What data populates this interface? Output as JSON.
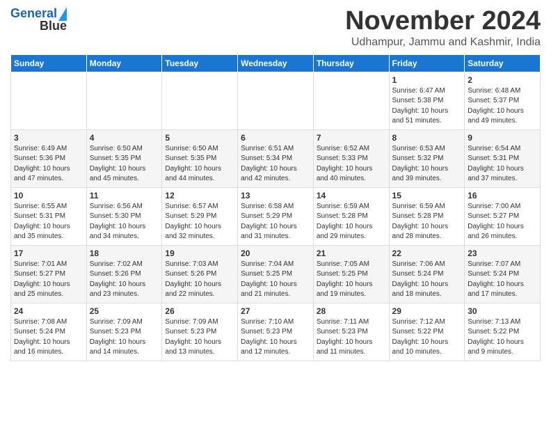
{
  "logo": {
    "line1": "General",
    "line2": "Blue"
  },
  "header": {
    "month": "November 2024",
    "location": "Udhampur, Jammu and Kashmir, India"
  },
  "weekdays": [
    "Sunday",
    "Monday",
    "Tuesday",
    "Wednesday",
    "Thursday",
    "Friday",
    "Saturday"
  ],
  "rows": [
    [
      {
        "day": "",
        "detail": ""
      },
      {
        "day": "",
        "detail": ""
      },
      {
        "day": "",
        "detail": ""
      },
      {
        "day": "",
        "detail": ""
      },
      {
        "day": "",
        "detail": ""
      },
      {
        "day": "1",
        "detail": "Sunrise: 6:47 AM\nSunset: 5:38 PM\nDaylight: 10 hours\nand 51 minutes."
      },
      {
        "day": "2",
        "detail": "Sunrise: 6:48 AM\nSunset: 5:37 PM\nDaylight: 10 hours\nand 49 minutes."
      }
    ],
    [
      {
        "day": "3",
        "detail": "Sunrise: 6:49 AM\nSunset: 5:36 PM\nDaylight: 10 hours\nand 47 minutes."
      },
      {
        "day": "4",
        "detail": "Sunrise: 6:50 AM\nSunset: 5:35 PM\nDaylight: 10 hours\nand 45 minutes."
      },
      {
        "day": "5",
        "detail": "Sunrise: 6:50 AM\nSunset: 5:35 PM\nDaylight: 10 hours\nand 44 minutes."
      },
      {
        "day": "6",
        "detail": "Sunrise: 6:51 AM\nSunset: 5:34 PM\nDaylight: 10 hours\nand 42 minutes."
      },
      {
        "day": "7",
        "detail": "Sunrise: 6:52 AM\nSunset: 5:33 PM\nDaylight: 10 hours\nand 40 minutes."
      },
      {
        "day": "8",
        "detail": "Sunrise: 6:53 AM\nSunset: 5:32 PM\nDaylight: 10 hours\nand 39 minutes."
      },
      {
        "day": "9",
        "detail": "Sunrise: 6:54 AM\nSunset: 5:31 PM\nDaylight: 10 hours\nand 37 minutes."
      }
    ],
    [
      {
        "day": "10",
        "detail": "Sunrise: 6:55 AM\nSunset: 5:31 PM\nDaylight: 10 hours\nand 35 minutes."
      },
      {
        "day": "11",
        "detail": "Sunrise: 6:56 AM\nSunset: 5:30 PM\nDaylight: 10 hours\nand 34 minutes."
      },
      {
        "day": "12",
        "detail": "Sunrise: 6:57 AM\nSunset: 5:29 PM\nDaylight: 10 hours\nand 32 minutes."
      },
      {
        "day": "13",
        "detail": "Sunrise: 6:58 AM\nSunset: 5:29 PM\nDaylight: 10 hours\nand 31 minutes."
      },
      {
        "day": "14",
        "detail": "Sunrise: 6:59 AM\nSunset: 5:28 PM\nDaylight: 10 hours\nand 29 minutes."
      },
      {
        "day": "15",
        "detail": "Sunrise: 6:59 AM\nSunset: 5:28 PM\nDaylight: 10 hours\nand 28 minutes."
      },
      {
        "day": "16",
        "detail": "Sunrise: 7:00 AM\nSunset: 5:27 PM\nDaylight: 10 hours\nand 26 minutes."
      }
    ],
    [
      {
        "day": "17",
        "detail": "Sunrise: 7:01 AM\nSunset: 5:27 PM\nDaylight: 10 hours\nand 25 minutes."
      },
      {
        "day": "18",
        "detail": "Sunrise: 7:02 AM\nSunset: 5:26 PM\nDaylight: 10 hours\nand 23 minutes."
      },
      {
        "day": "19",
        "detail": "Sunrise: 7:03 AM\nSunset: 5:26 PM\nDaylight: 10 hours\nand 22 minutes."
      },
      {
        "day": "20",
        "detail": "Sunrise: 7:04 AM\nSunset: 5:25 PM\nDaylight: 10 hours\nand 21 minutes."
      },
      {
        "day": "21",
        "detail": "Sunrise: 7:05 AM\nSunset: 5:25 PM\nDaylight: 10 hours\nand 19 minutes."
      },
      {
        "day": "22",
        "detail": "Sunrise: 7:06 AM\nSunset: 5:24 PM\nDaylight: 10 hours\nand 18 minutes."
      },
      {
        "day": "23",
        "detail": "Sunrise: 7:07 AM\nSunset: 5:24 PM\nDaylight: 10 hours\nand 17 minutes."
      }
    ],
    [
      {
        "day": "24",
        "detail": "Sunrise: 7:08 AM\nSunset: 5:24 PM\nDaylight: 10 hours\nand 16 minutes."
      },
      {
        "day": "25",
        "detail": "Sunrise: 7:09 AM\nSunset: 5:23 PM\nDaylight: 10 hours\nand 14 minutes."
      },
      {
        "day": "26",
        "detail": "Sunrise: 7:09 AM\nSunset: 5:23 PM\nDaylight: 10 hours\nand 13 minutes."
      },
      {
        "day": "27",
        "detail": "Sunrise: 7:10 AM\nSunset: 5:23 PM\nDaylight: 10 hours\nand 12 minutes."
      },
      {
        "day": "28",
        "detail": "Sunrise: 7:11 AM\nSunset: 5:23 PM\nDaylight: 10 hours\nand 11 minutes."
      },
      {
        "day": "29",
        "detail": "Sunrise: 7:12 AM\nSunset: 5:22 PM\nDaylight: 10 hours\nand 10 minutes."
      },
      {
        "day": "30",
        "detail": "Sunrise: 7:13 AM\nSunset: 5:22 PM\nDaylight: 10 hours\nand 9 minutes."
      }
    ]
  ]
}
